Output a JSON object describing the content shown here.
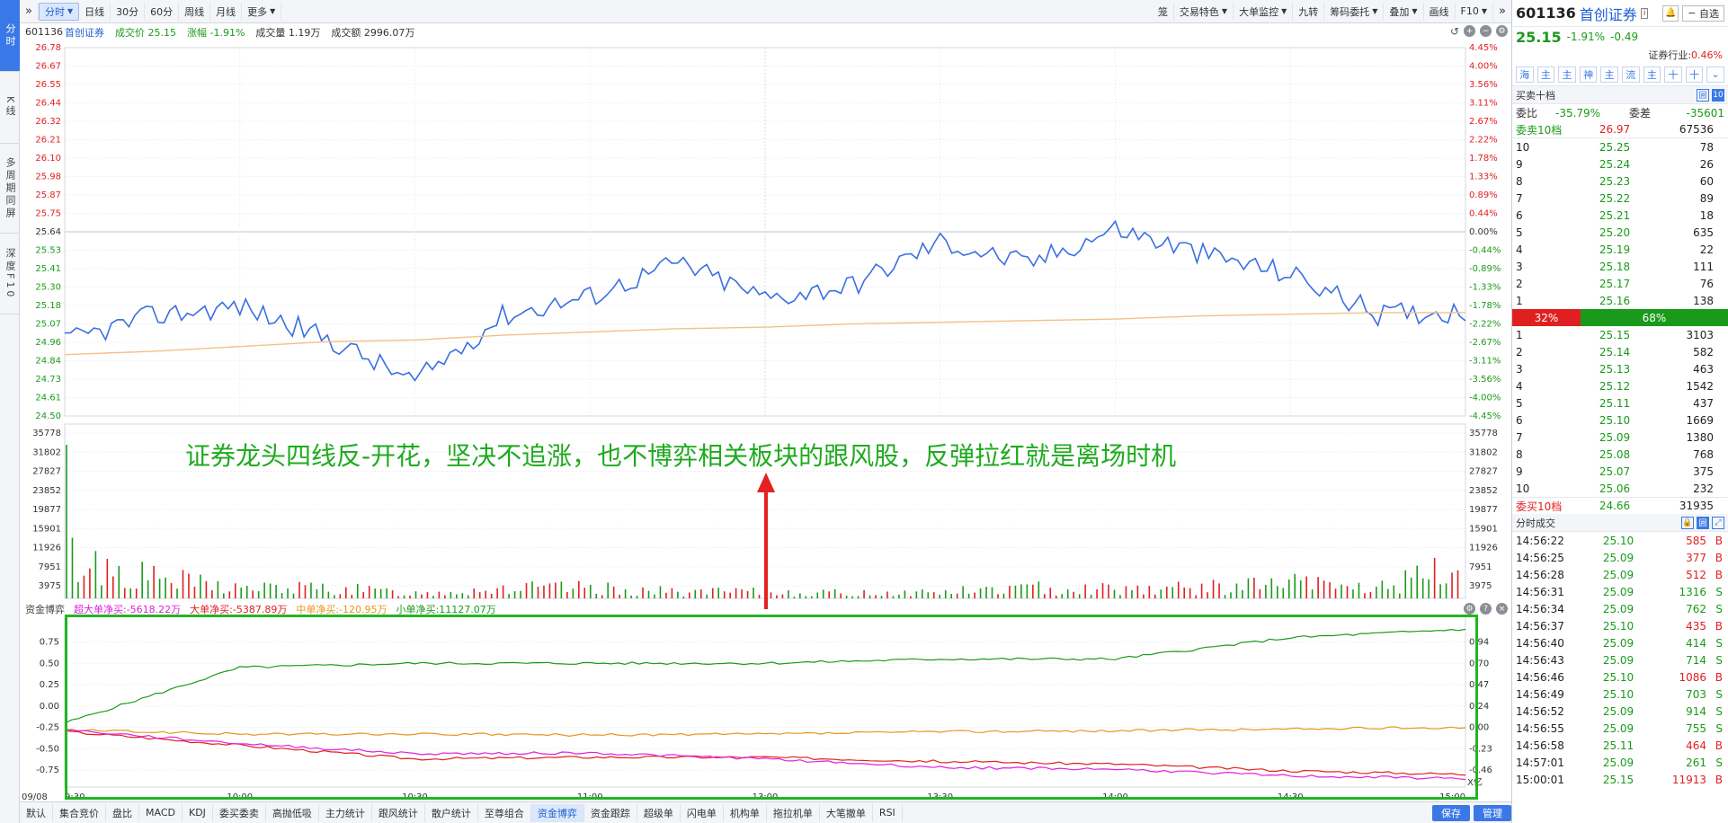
{
  "left_tabs": [
    {
      "label": "分时",
      "active": true
    },
    {
      "label": "K线",
      "active": false
    },
    {
      "label": "多周期同屏",
      "active": false
    },
    {
      "label": "深度F10",
      "active": false
    }
  ],
  "toolbar": {
    "left": [
      {
        "label": "分时",
        "active": true,
        "caret": true
      },
      {
        "label": "日线"
      },
      {
        "label": "30分"
      },
      {
        "label": "60分"
      },
      {
        "label": "周线"
      },
      {
        "label": "月线"
      },
      {
        "label": "更多",
        "caret": true
      }
    ],
    "right": [
      {
        "label": "笼"
      },
      {
        "label": "交易特色",
        "caret": true
      },
      {
        "label": "大单监控",
        "caret": true
      },
      {
        "label": "九转"
      },
      {
        "label": "筹码委托",
        "caret": true
      },
      {
        "label": "叠加",
        "caret": true
      },
      {
        "label": "画线"
      },
      {
        "label": "F10",
        "caret": true
      }
    ]
  },
  "info": {
    "code": "601136",
    "name": "首创证券",
    "price_label": "成交价",
    "price": "25.15",
    "chg_label": "涨幅",
    "chg": "-1.91%",
    "vol_label": "成交量",
    "vol": "1.19万",
    "amt_label": "成交额",
    "amt": "2996.07万"
  },
  "price_axis": {
    "left": [
      "26.78",
      "26.67",
      "26.55",
      "26.44",
      "26.32",
      "26.21",
      "26.10",
      "25.98",
      "25.87",
      "25.75",
      "25.64",
      "25.53",
      "25.41",
      "25.30",
      "25.18",
      "25.07",
      "24.96",
      "24.84",
      "24.73",
      "24.61",
      "24.50"
    ],
    "right": [
      "4.45%",
      "4.00%",
      "3.56%",
      "3.11%",
      "2.67%",
      "2.22%",
      "1.78%",
      "1.33%",
      "0.89%",
      "0.44%",
      "0.00%",
      "-0.44%",
      "-0.89%",
      "-1.33%",
      "-1.78%",
      "-2.22%",
      "-2.67%",
      "-3.11%",
      "-3.56%",
      "-4.00%",
      "-4.45%"
    ]
  },
  "vol_axis": [
    "35778",
    "31802",
    "27827",
    "23852",
    "19877",
    "15901",
    "11926",
    "7951",
    "3975"
  ],
  "time_axis": [
    "09/08",
    "9:30",
    "10:00",
    "10:30",
    "11:00",
    "13:00",
    "13:30",
    "14:00",
    "14:30",
    "15:00"
  ],
  "chart_data": [
    {
      "type": "line",
      "title": "分时",
      "ylim": [
        24.5,
        26.78
      ],
      "prev_close": 25.64,
      "x": [
        "09:30",
        "09:45",
        "10:00",
        "10:15",
        "10:30",
        "10:45",
        "11:00",
        "11:15",
        "11:30/13:00",
        "13:15",
        "13:30",
        "13:45",
        "14:00",
        "14:15",
        "14:30",
        "14:45",
        "15:00"
      ],
      "series": [
        {
          "name": "价格",
          "color": "#3a6fe0",
          "values": [
            24.96,
            25.12,
            25.18,
            24.98,
            24.71,
            25.12,
            25.24,
            25.45,
            25.23,
            25.31,
            25.58,
            25.44,
            25.66,
            25.5,
            25.38,
            25.13,
            25.15
          ]
        },
        {
          "name": "均价",
          "color": "#f4c08a",
          "values": [
            24.88,
            24.9,
            24.93,
            24.96,
            24.97,
            25.0,
            25.02,
            25.04,
            25.05,
            25.07,
            25.08,
            25.09,
            25.1,
            25.12,
            25.13,
            25.14,
            25.14
          ]
        }
      ]
    },
    {
      "type": "bar",
      "title": "成交量",
      "ylim": [
        0,
        39750
      ],
      "peak_values": [
        15800,
        7951,
        3975,
        3975,
        2000,
        3975,
        3975,
        2500,
        2500,
        2000,
        2500,
        3975,
        3975,
        3975,
        6000,
        3975,
        11926
      ]
    },
    {
      "type": "line",
      "title": "资金博弈",
      "ylim": [
        -0.95,
        1.05
      ],
      "x": [
        "09:30",
        "10:00",
        "10:30",
        "11:00",
        "11:30/13:00",
        "13:30",
        "14:00",
        "14:30",
        "15:00"
      ],
      "series": [
        {
          "name": "小单净买",
          "color": "#1a9a1a",
          "values": [
            -0.2,
            0.45,
            0.5,
            0.5,
            0.5,
            0.55,
            0.55,
            0.8,
            0.9
          ]
        },
        {
          "name": "中单净买",
          "color": "#e89520",
          "values": [
            -0.28,
            -0.33,
            -0.33,
            -0.34,
            -0.33,
            -0.3,
            -0.29,
            -0.27,
            -0.25
          ]
        },
        {
          "name": "大单净买",
          "color": "#e02020",
          "values": [
            -0.3,
            -0.46,
            -0.62,
            -0.6,
            -0.6,
            -0.65,
            -0.68,
            -0.76,
            -0.8
          ]
        },
        {
          "name": "超大单净买",
          "color": "#e020e0",
          "values": [
            -0.28,
            -0.44,
            -0.56,
            -0.55,
            -0.62,
            -0.72,
            -0.74,
            -0.82,
            -0.85
          ]
        }
      ]
    }
  ],
  "fund": {
    "title": "资金博弈",
    "labels": [
      {
        "text": "超大单净买:-5618.22万",
        "color": "#e020e0"
      },
      {
        "text": "大单净买:-5387.89万",
        "color": "#e02020"
      },
      {
        "text": "中单净买:-120.95万",
        "color": "#e89520"
      },
      {
        "text": "小单净买:11127.07万",
        "color": "#1a9a1a"
      }
    ],
    "left_axis": [
      "0.75",
      "0.50",
      "0.25",
      "0.00",
      "-0.25",
      "-0.50",
      "-0.75"
    ],
    "right_axis": [
      "0.94",
      "0.70",
      "0.47",
      "0.24",
      "0.00",
      "-0.23",
      "-0.46"
    ],
    "unit": "X亿"
  },
  "annotation": "证券龙头四线反-开花，坚决不追涨，也不博弈相关板块的跟风股，反弹拉红就是离场时机",
  "bottom_tabs": [
    "默认",
    "集合竞价",
    "盘比",
    "MACD",
    "KDJ",
    "委买委卖",
    "高抛低吸",
    "主力统计",
    "跟风统计",
    "散户统计",
    "至尊组合",
    "资金博弈",
    "资金跟踪",
    "超级单",
    "闪电单",
    "机构单",
    "拖拉机单",
    "大笔撤单",
    "RSI"
  ],
  "bottom_active": "资金博弈",
  "bottom_buttons": [
    "保存",
    "管理"
  ],
  "panel": {
    "code": "601136",
    "name": "首创证券",
    "tag": "i",
    "fav": "自选",
    "price": "25.15",
    "pct": "-1.91%",
    "chg": "-0.49",
    "industry_label": "证券行业:",
    "industry_val": "0.46%",
    "icons": [
      "海",
      "主",
      "主",
      "神",
      "主",
      "流",
      "主",
      "十",
      "十"
    ],
    "book_title": "买卖十档",
    "weibi_label": "委比",
    "weibi": "-35.79%",
    "weicha_label": "委差",
    "weicha": "-35601",
    "ask_total": {
      "label": "委卖10档",
      "price": "26.97",
      "vol": "67536"
    },
    "asks": [
      {
        "n": "10",
        "p": "25.25",
        "v": "78"
      },
      {
        "n": "9",
        "p": "25.24",
        "v": "26"
      },
      {
        "n": "8",
        "p": "25.23",
        "v": "60"
      },
      {
        "n": "7",
        "p": "25.22",
        "v": "89"
      },
      {
        "n": "6",
        "p": "25.21",
        "v": "18"
      },
      {
        "n": "5",
        "p": "25.20",
        "v": "635"
      },
      {
        "n": "4",
        "p": "25.19",
        "v": "22"
      },
      {
        "n": "3",
        "p": "25.18",
        "v": "111"
      },
      {
        "n": "2",
        "p": "25.17",
        "v": "76"
      },
      {
        "n": "1",
        "p": "25.16",
        "v": "138"
      }
    ],
    "ratio_buy": "32%",
    "ratio_sell": "68%",
    "bids": [
      {
        "n": "1",
        "p": "25.15",
        "v": "3103"
      },
      {
        "n": "2",
        "p": "25.14",
        "v": "582"
      },
      {
        "n": "3",
        "p": "25.13",
        "v": "463"
      },
      {
        "n": "4",
        "p": "25.12",
        "v": "1542"
      },
      {
        "n": "5",
        "p": "25.11",
        "v": "437"
      },
      {
        "n": "6",
        "p": "25.10",
        "v": "1669"
      },
      {
        "n": "7",
        "p": "25.09",
        "v": "1380"
      },
      {
        "n": "8",
        "p": "25.08",
        "v": "768"
      },
      {
        "n": "9",
        "p": "25.07",
        "v": "375"
      },
      {
        "n": "10",
        "p": "25.06",
        "v": "232"
      }
    ],
    "bid_total": {
      "label": "委买10档",
      "price": "24.66",
      "vol": "31935"
    },
    "trades_title": "分时成交",
    "trades": [
      {
        "t": "14:56:22",
        "p": "25.10",
        "v": "585",
        "s": "B"
      },
      {
        "t": "14:56:25",
        "p": "25.09",
        "v": "377",
        "s": "B"
      },
      {
        "t": "14:56:28",
        "p": "25.09",
        "v": "512",
        "s": "B"
      },
      {
        "t": "14:56:31",
        "p": "25.09",
        "v": "1316",
        "s": "S"
      },
      {
        "t": "14:56:34",
        "p": "25.09",
        "v": "762",
        "s": "S"
      },
      {
        "t": "14:56:37",
        "p": "25.10",
        "v": "435",
        "s": "B"
      },
      {
        "t": "14:56:40",
        "p": "25.09",
        "v": "414",
        "s": "S"
      },
      {
        "t": "14:56:43",
        "p": "25.09",
        "v": "714",
        "s": "S"
      },
      {
        "t": "14:56:46",
        "p": "25.10",
        "v": "1086",
        "s": "B"
      },
      {
        "t": "14:56:49",
        "p": "25.10",
        "v": "703",
        "s": "S"
      },
      {
        "t": "14:56:52",
        "p": "25.09",
        "v": "914",
        "s": "S"
      },
      {
        "t": "14:56:55",
        "p": "25.09",
        "v": "755",
        "s": "S"
      },
      {
        "t": "14:56:58",
        "p": "25.11",
        "v": "464",
        "s": "B"
      },
      {
        "t": "14:57:01",
        "p": "25.09",
        "v": "261",
        "s": "S"
      },
      {
        "t": "15:00:01",
        "p": "25.15",
        "v": "11913",
        "s": "B"
      }
    ]
  }
}
